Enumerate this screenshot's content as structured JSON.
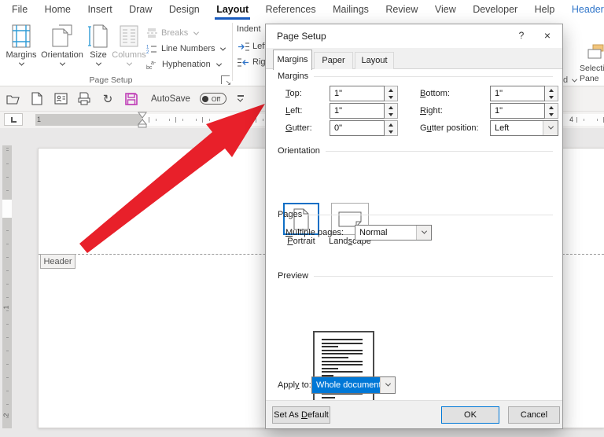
{
  "menu_bar": {
    "tabs": [
      "File",
      "Home",
      "Insert",
      "Draw",
      "Design",
      "Layout",
      "References",
      "Mailings",
      "Review",
      "View",
      "Developer",
      "Help",
      "Header"
    ],
    "active_tab": "Layout"
  },
  "ribbon": {
    "buttons": {
      "margins": "Margins",
      "orientation": "Orientation",
      "size": "Size",
      "columns": "Columns",
      "breaks": "Breaks",
      "line_numbers": "Line Numbers",
      "hyphenation": "Hyphenation"
    },
    "group_label": "Page Setup",
    "indent": {
      "title": "Indent",
      "left": "Left",
      "right": "Right"
    },
    "arrange": {
      "line1": "Selection",
      "line2": "Pane",
      "stub": "d"
    }
  },
  "qat": {
    "autosave": "AutoSave",
    "autosave_state": "Off"
  },
  "ruler": {
    "h_numbers": {
      "left": "1",
      "mid": "1",
      "right": "4"
    },
    "v_numbers": {
      "n1": "1",
      "n2": "2"
    }
  },
  "document": {
    "header_badge": "Header"
  },
  "dialog": {
    "title": "Page Setup",
    "help_glyph": "?",
    "close_glyph": "×",
    "tabs": [
      "Margins",
      "Paper",
      "Layout"
    ],
    "sections": {
      "margins": "Margins",
      "orientation": "Orientation",
      "pages": "Pages",
      "preview": "Preview"
    },
    "fields": {
      "top": {
        "pre": "",
        "key": "T",
        "post": "op:",
        "value": "1\""
      },
      "bottom": {
        "pre": "",
        "key": "B",
        "post": "ottom:",
        "value": "1\""
      },
      "left": {
        "pre": "",
        "key": "L",
        "post": "eft:",
        "value": "1\""
      },
      "right": {
        "pre": "",
        "key": "R",
        "post": "ight:",
        "value": "1\""
      },
      "gutter": {
        "pre": "",
        "key": "G",
        "post": "utter:",
        "value": "0\""
      },
      "gutter_position": {
        "pre": "G",
        "key": "u",
        "post": "tter position:",
        "value": "Left"
      }
    },
    "orientation": {
      "portrait": {
        "pre": "",
        "key": "P",
        "post": "ortrait"
      },
      "landscape": {
        "pre": "Land",
        "key": "s",
        "post": "cape"
      }
    },
    "pages": {
      "label": {
        "pre": "",
        "key": "M",
        "post": "ultiple pages:"
      },
      "value": "Normal"
    },
    "apply": {
      "label": {
        "pre": "Appl",
        "key": "y",
        "post": " to:"
      },
      "value": "Whole document"
    },
    "buttons": {
      "set_default": {
        "pre": "Set As ",
        "key": "D",
        "post": "efault"
      },
      "ok": "OK",
      "cancel": "Cancel"
    },
    "preview_lines": [
      92,
      92,
      38,
      92,
      92,
      60,
      92,
      92,
      38,
      92,
      26,
      92,
      92,
      55,
      92,
      92,
      30
    ]
  },
  "colors": {
    "accent_blue": "#0078D7",
    "tab_underline": "#185ABD",
    "contextual_tab_blue": "#2E74C9",
    "arrow_red": "#E8202A",
    "save_icon_magenta": "#BF3BB6",
    "selected_dropdown_bg": "#0078D7",
    "ruler_margin_gray": "#CBCAC8",
    "document_bg": "#E9E8E8"
  }
}
